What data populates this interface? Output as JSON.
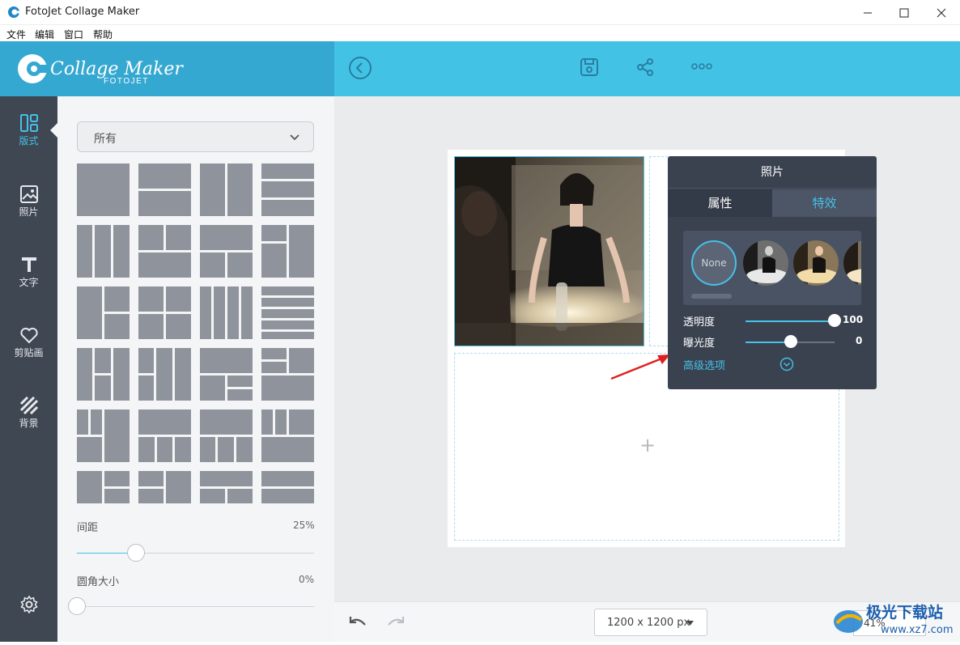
{
  "window": {
    "title": "FotoJet Collage Maker"
  },
  "menu": [
    "文件",
    "编辑",
    "窗口",
    "帮助"
  ],
  "brand": {
    "logo_text": "Collage Maker",
    "logo_sub": "FOTOJET"
  },
  "nav": [
    {
      "label": "版式",
      "icon": "layout-icon",
      "active": true
    },
    {
      "label": "照片",
      "icon": "photo-icon",
      "active": false
    },
    {
      "label": "文字",
      "icon": "text-icon",
      "active": false
    },
    {
      "label": "剪贴画",
      "icon": "heart-icon",
      "active": false
    },
    {
      "label": "背景",
      "icon": "background-icon",
      "active": false
    }
  ],
  "panel": {
    "filter_label": "所有",
    "spacing": {
      "label": "间距",
      "value": "25%",
      "level": 0.25
    },
    "corner": {
      "label": "圆角大小",
      "value": "0%",
      "level": 0
    }
  },
  "popup": {
    "title": "照片",
    "tabs": [
      "属性",
      "特效"
    ],
    "active_tab": "特效",
    "filter_none": "None",
    "opacity": {
      "label": "透明度",
      "value": "100",
      "level": 1.0
    },
    "exposure": {
      "label": "曝光度",
      "value": "0",
      "level": 0.5
    },
    "advanced": "高级选项"
  },
  "canvas": {
    "add_symbol": "+"
  },
  "bottom": {
    "size": "1200 x 1200 px",
    "zoom": "41%"
  },
  "watermark": {
    "text": "极光下载站",
    "url": "www.xz7.com"
  },
  "colors": {
    "accent": "#46c1e8",
    "header": "#42c3e6",
    "nav_bg": "#3f4753",
    "tile": "#8f939b"
  }
}
